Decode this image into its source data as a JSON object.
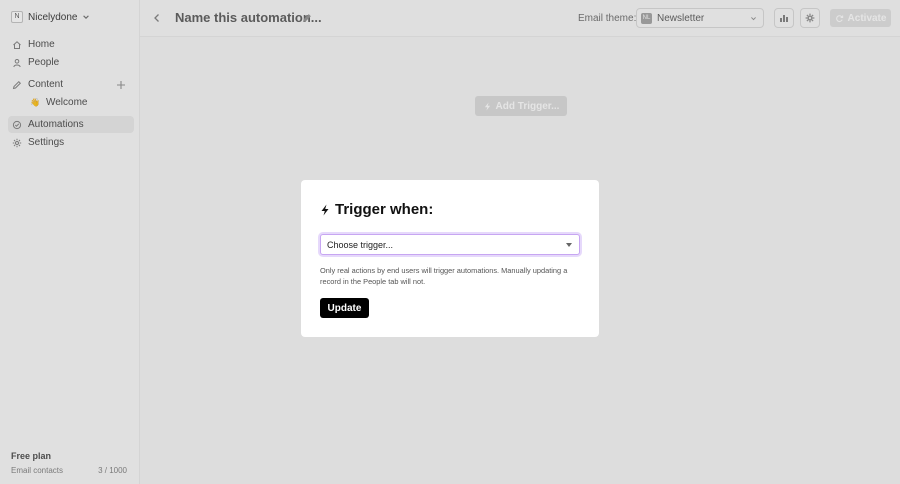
{
  "workspace": {
    "initial": "N",
    "name": "Nicelydone"
  },
  "nav": {
    "home": "Home",
    "people": "People",
    "content": "Content",
    "welcome": "Welcome",
    "welcome_emoji": "👋",
    "automations": "Automations",
    "settings": "Settings"
  },
  "plan": {
    "title": "Free plan",
    "contacts_label": "Email contacts",
    "contacts_value": "3 / 1000"
  },
  "header": {
    "title": "Name this automation...",
    "theme_label": "Email theme:",
    "theme_icon_text": "NL",
    "theme_value": "Newsletter",
    "activate_label": "Activate"
  },
  "canvas": {
    "add_trigger_label": "Add Trigger..."
  },
  "modal": {
    "title": "Trigger when:",
    "select_value": "Choose trigger...",
    "help_text": "Only real actions by end users will trigger automations. Manually updating a record in the People tab will not.",
    "update_label": "Update"
  },
  "colors": {
    "accent_focus": "#c7a6f2",
    "primary_button": "#000000"
  },
  "icons": [
    "chevron-down-icon",
    "home-icon",
    "person-icon",
    "pencil-icon",
    "plus-icon",
    "automation-icon",
    "gear-icon",
    "back-arrow-icon",
    "bar-chart-icon",
    "refresh-icon",
    "lightning-icon"
  ]
}
